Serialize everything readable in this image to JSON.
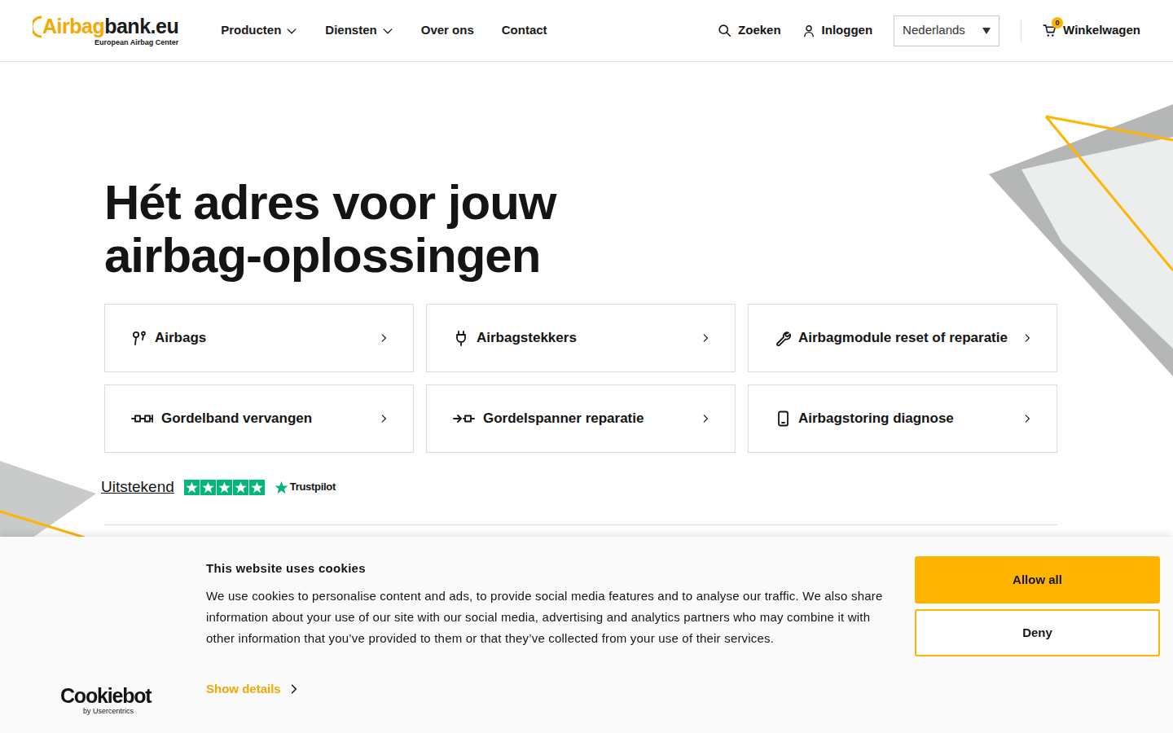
{
  "logo": {
    "parts": [
      {
        "text": "Airbag",
        "color": "#f5a800"
      },
      {
        "text": "bank",
        "color": "#1a1a1a"
      },
      {
        "text": ".eu",
        "color": "#1a1a1a"
      }
    ],
    "tagline": "European Airbag Center"
  },
  "nav": [
    {
      "label": "Producten",
      "has_menu": true
    },
    {
      "label": "Diensten",
      "has_menu": true
    },
    {
      "label": "Over ons",
      "has_menu": false
    },
    {
      "label": "Contact",
      "has_menu": false
    }
  ],
  "header": {
    "search": "Zoeken",
    "login": "Inloggen",
    "language": "Nederlands",
    "cart": {
      "label": "Winkelwagen",
      "count": "0"
    }
  },
  "hero": {
    "title_lines": [
      "Hét adres voor jouw",
      "airbag-oplossingen"
    ]
  },
  "tiles": [
    {
      "label": "Airbags"
    },
    {
      "label": "Airbagstekkers"
    },
    {
      "label": "Airbagmodule reset of reparatie"
    },
    {
      "label": "Gordelband vervangen"
    },
    {
      "label": "Gordelspanner reparatie"
    },
    {
      "label": "Airbagstoring diagnose"
    }
  ],
  "rating": {
    "label": "Uitstekend",
    "stars": 5,
    "brand": "Trustpilot"
  },
  "cookie_banner": {
    "title": "This website uses cookies",
    "body": "We use cookies to personalise content and ads, to provide social media features and to analyse our traffic. We also share information about your use of our site with our social media, advertising and analytics partners who may combine it with other information that you’ve provided to them or that they’ve collected from your use of their services.",
    "details": "Show details",
    "buttons": [
      {
        "label": "Allow all",
        "kind": "primary"
      },
      {
        "label": "Deny",
        "kind": "outline"
      }
    ],
    "brand": "Cookiebot",
    "brand_sub": "by Usercentrics"
  }
}
